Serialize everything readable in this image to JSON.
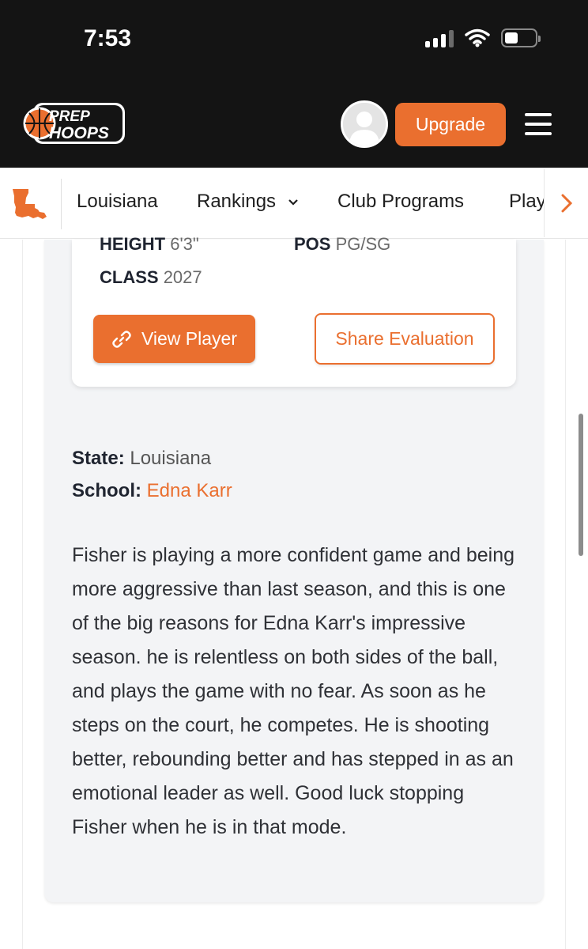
{
  "status_bar": {
    "time": "7:53"
  },
  "header": {
    "logo_line1": "PREP",
    "logo_line2": "HOOPS",
    "upgrade_label": "Upgrade"
  },
  "nav": {
    "items": [
      {
        "label": "Louisiana"
      },
      {
        "label": "Rankings"
      },
      {
        "label": "Club Programs"
      },
      {
        "label": "Play"
      }
    ],
    "rankings_chevron": "⌄",
    "more_icon": "chevron-right-icon"
  },
  "player_card": {
    "height_label": "HEIGHT",
    "height_value": "6'3\"",
    "pos_label": "POS",
    "pos_value": "PG/SG",
    "class_label": "CLASS",
    "class_value": "2027",
    "view_player_label": "View Player",
    "share_label": "Share Evaluation"
  },
  "details": {
    "state_label": "State:",
    "state_value": "Louisiana",
    "school_label": "School:",
    "school_value": "Edna Karr"
  },
  "evaluation_text": "Fisher is playing a more confident game and being more aggressive than last season, and this is one of the big reasons for Edna Karr's impressive season. he is relentless on both sides of the ball, and plays the game with no fear. As soon as he steps on the court, he competes. He is shooting better, rebounding better and has stepped in as an emotional leader as well. Good luck stopping Fisher when he is in that mode.",
  "colors": {
    "accent": "#ea6f2f",
    "header_bg": "#141414",
    "panel_bg": "#f3f4f6"
  }
}
